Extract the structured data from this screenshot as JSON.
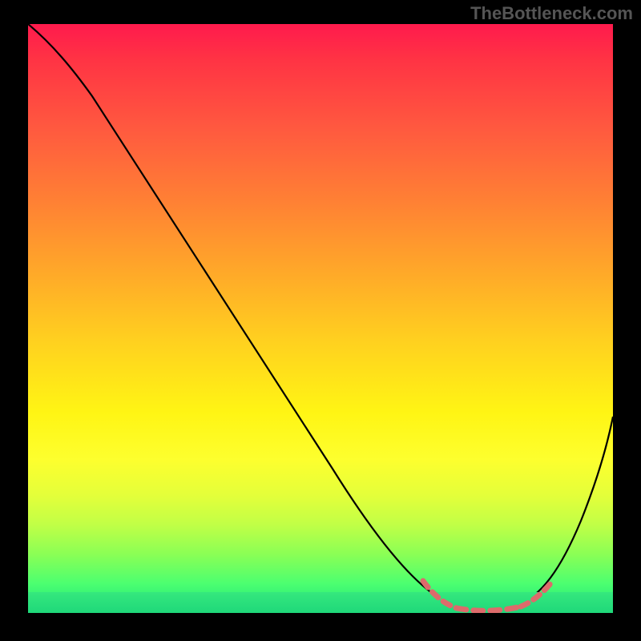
{
  "watermark": "TheBottleneck.com",
  "chart_data": {
    "type": "line",
    "title": "",
    "xlabel": "",
    "ylabel": "",
    "xlim": [
      0,
      100
    ],
    "ylim": [
      0,
      100
    ],
    "grid": false,
    "series": [
      {
        "name": "curve",
        "color": "#000000",
        "x": [
          0,
          6,
          12,
          20,
          30,
          40,
          50,
          58,
          64,
          70,
          74,
          78,
          82,
          86,
          90,
          94,
          100
        ],
        "values": [
          100,
          96,
          91,
          82,
          69,
          56,
          43,
          32,
          24,
          15,
          9,
          5,
          3,
          3,
          8,
          18,
          34
        ]
      }
    ],
    "annotations": {
      "valley_dashed_segment": {
        "color": "#e06666",
        "x_start": 70,
        "x_end": 90,
        "y_approx": 3
      }
    },
    "colors": {
      "background_gradient_top": "#ff1a4d",
      "background_gradient_bottom": "#18e07e",
      "curve": "#000000",
      "dash": "#e06666",
      "frame": "#000000"
    }
  }
}
